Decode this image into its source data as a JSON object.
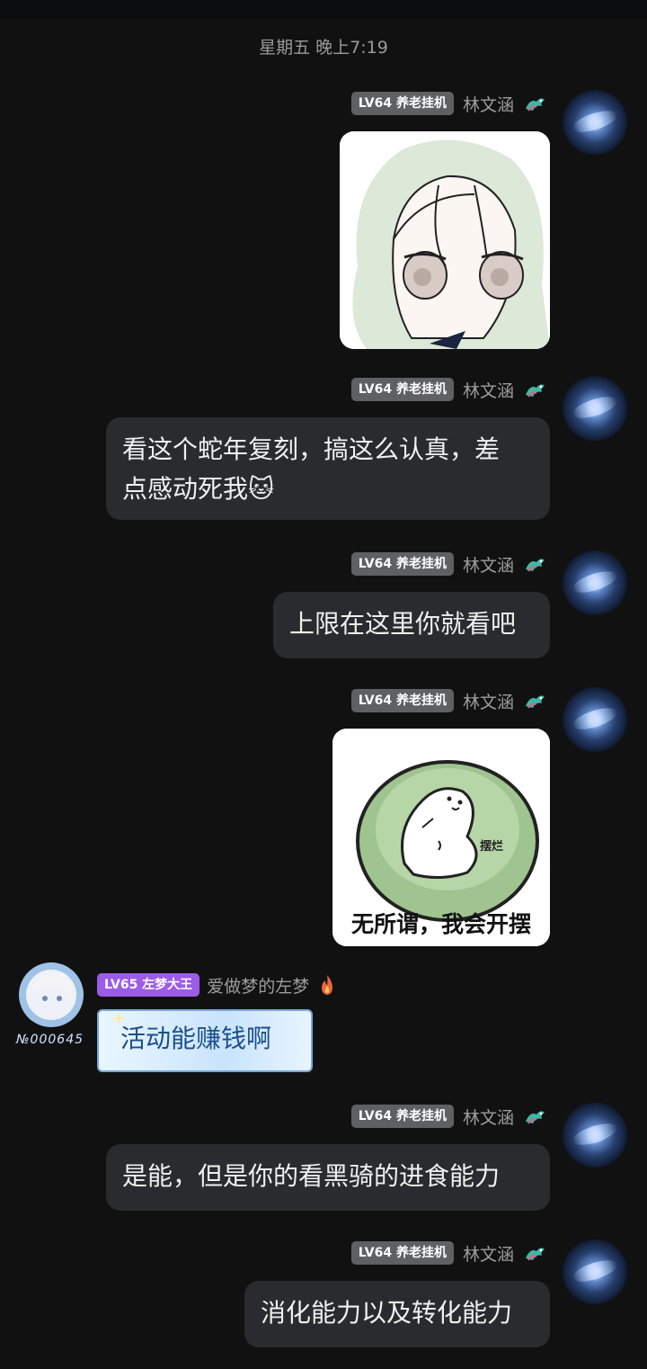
{
  "timestamp": "星期五 晚上7:19",
  "colors": {
    "background": "#111112",
    "bubble": "#2a2b2f",
    "badge_gray": "#5f6062",
    "badge_purple": "#9b5ce8"
  },
  "messages": [
    {
      "badge": "LV64 养老挂机",
      "name": "林文涵",
      "type": "sticker",
      "icon": "dragon-icon"
    },
    {
      "badge": "LV64 养老挂机",
      "name": "林文涵",
      "type": "text",
      "lines": [
        "看这个蛇年复刻，搞这么认真，差",
        "点感动死我"
      ],
      "emoji": "🐱",
      "icon": "dragon-icon"
    },
    {
      "badge": "LV64 养老挂机",
      "name": "林文涵",
      "type": "text",
      "text": "上限在这里你就看吧",
      "icon": "dragon-icon"
    },
    {
      "badge": "LV64 养老挂机",
      "name": "林文涵",
      "type": "sticker",
      "sticker_label": "摆烂",
      "caption": "无所谓，我会开摆",
      "icon": "dragon-icon"
    },
    {
      "badge": "LV65 左梦大王",
      "name": "爱做梦的左梦",
      "type": "text",
      "text": "活动能赚钱啊",
      "avatar_number": "№000645",
      "icon": "fire-icon"
    },
    {
      "badge": "LV64 养老挂机",
      "name": "林文涵",
      "type": "text",
      "text": "是能，但是你的看黑骑的进食能力",
      "icon": "dragon-icon"
    },
    {
      "badge": "LV64 养老挂机",
      "name": "林文涵",
      "type": "text",
      "text": "消化能力以及转化能力",
      "icon": "dragon-icon"
    }
  ]
}
